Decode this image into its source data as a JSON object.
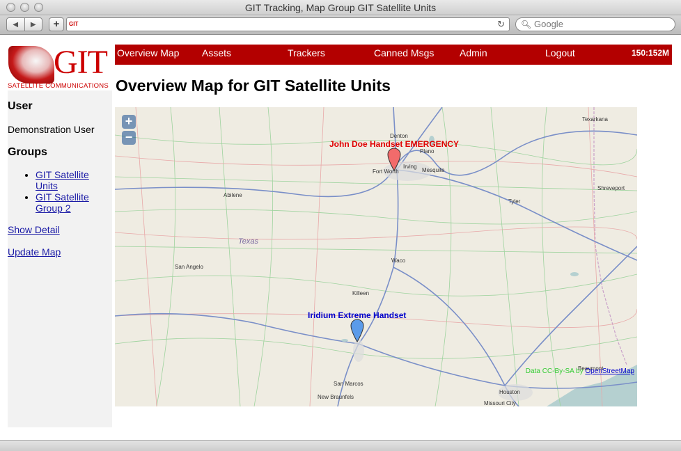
{
  "window": {
    "title": "GIT Tracking, Map Group GIT Satellite Units"
  },
  "browser": {
    "search_placeholder": "Google",
    "favicon_text": "GIT"
  },
  "logo": {
    "name": "GIT",
    "tagline": "SATELLITE COMMUNICATIONS"
  },
  "sidebar": {
    "user_heading": "User",
    "user_name": "Demonstration User",
    "groups_heading": "Groups",
    "groups": [
      {
        "label": "GIT Satellite Units"
      },
      {
        "label": "GIT Satellite Group 2"
      }
    ],
    "show_detail": "Show Detail",
    "update_map": "Update Map"
  },
  "nav": {
    "items": [
      "Overview Map",
      "Assets",
      "Trackers",
      "Canned Msgs",
      "Admin",
      "Logout"
    ],
    "clock": "150:152M"
  },
  "main": {
    "title": "Overview Map for GIT Satellite Units"
  },
  "map": {
    "zoom_in": "+",
    "zoom_out": "−",
    "region_label": "Texas",
    "cities": [
      "Denton",
      "Plano",
      "Texarkana",
      "Fort Worth",
      "Irving",
      "Mesquite",
      "Abilene",
      "Shreveport",
      "Tyler",
      "San Angelo",
      "Waco",
      "Killeen",
      "San Marcos",
      "New Braunfels",
      "Houston",
      "Missouri City",
      "Beaumont"
    ],
    "markers": [
      {
        "label": "John Doe Handset EMERGENCY",
        "color": "#f26b6b",
        "label_color": "#e00000"
      },
      {
        "label": "Iridium Extreme Handset",
        "color": "#5b9bea",
        "label_color": "#0000cc"
      }
    ],
    "attribution_text": "Data CC-By-SA by",
    "attribution_link": "OpenStreetMap"
  },
  "colors": {
    "nav_bg": "#b30000",
    "sidebar_bg": "#f2f2f2",
    "link": "#1a1aa6"
  }
}
